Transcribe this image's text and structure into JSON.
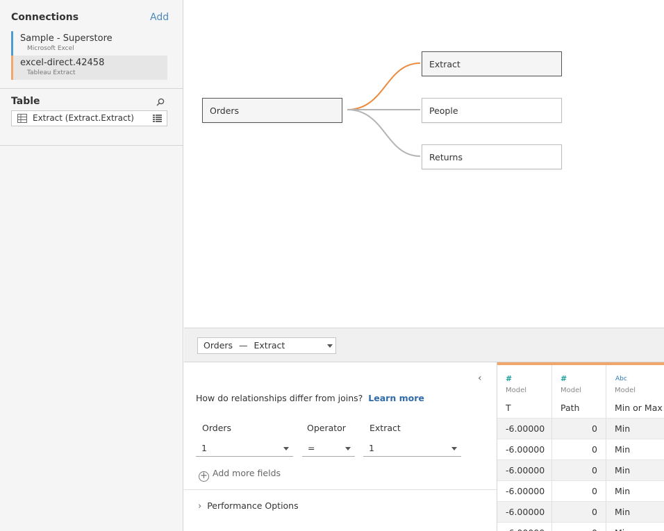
{
  "sidebar": {
    "connections_title": "Connections",
    "add_label": "Add",
    "connections": [
      {
        "name": "Sample - Superstore",
        "type": "Microsoft Excel",
        "accent": "#4e9ad2",
        "selected": false
      },
      {
        "name": "excel-direct.42458",
        "type": "Tableau Extract",
        "accent": "#f0a56a",
        "selected": true
      }
    ],
    "table_title": "Table",
    "tables": [
      {
        "name": "Extract (Extract.Extract)"
      }
    ]
  },
  "canvas": {
    "root": "Orders",
    "related": [
      "Extract",
      "People",
      "Returns"
    ],
    "selected_related": "Extract",
    "accent": "#ec8a3e",
    "link_color": "#b4b4b4"
  },
  "relationship": {
    "selector_left": "Orders",
    "selector_sep": "—",
    "selector_right": "Extract",
    "question": "How do relationships differ from joins?",
    "learn_more": "Learn more",
    "left_label": "Orders",
    "operator_label": "Operator",
    "right_label": "Extract",
    "left_value": "1",
    "operator_value": "=",
    "right_value": "1",
    "add_more": "Add more fields",
    "performance": "Performance Options"
  },
  "grid": {
    "columns": [
      {
        "type_icon": "#",
        "source": "Model",
        "name": "T",
        "align": "left"
      },
      {
        "type_icon": "#",
        "source": "Model",
        "name": "Path",
        "align": "right"
      },
      {
        "type_icon": "Abc",
        "source": "Model",
        "name": "Min or Max",
        "align": "left"
      }
    ],
    "rows": [
      [
        "-6.00000",
        "0",
        "Min"
      ],
      [
        "-6.00000",
        "0",
        "Min"
      ],
      [
        "-6.00000",
        "0",
        "Min"
      ],
      [
        "-6.00000",
        "0",
        "Min"
      ],
      [
        "-6.00000",
        "0",
        "Min"
      ],
      [
        "-6.00000",
        "0",
        "Min"
      ]
    ]
  }
}
